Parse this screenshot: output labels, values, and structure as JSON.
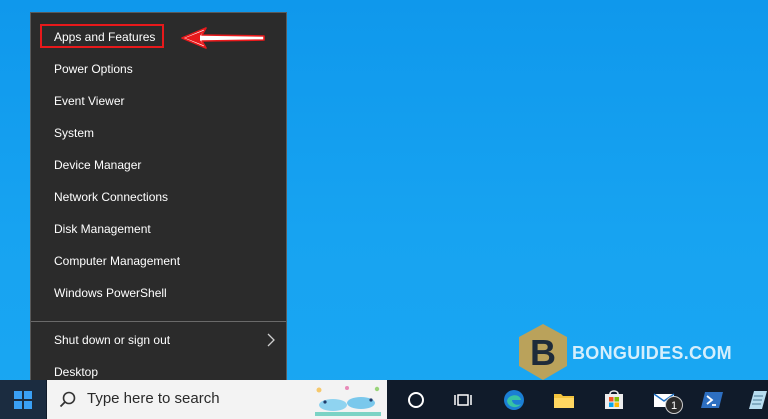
{
  "menu": {
    "items": [
      {
        "label": "Apps and Features"
      },
      {
        "label": "Power Options"
      },
      {
        "label": "Event Viewer"
      },
      {
        "label": "System"
      },
      {
        "label": "Device Manager"
      },
      {
        "label": "Network Connections"
      },
      {
        "label": "Disk Management"
      },
      {
        "label": "Computer Management"
      },
      {
        "label": "Windows PowerShell"
      },
      {
        "label": "Shut down or sign out"
      },
      {
        "label": "Desktop"
      }
    ],
    "highlight_color": "#e8191b"
  },
  "taskbar": {
    "search_placeholder": "Type here to search",
    "mail_badge": "1",
    "icons": [
      "windows-start-icon",
      "search-icon",
      "cortana-circle-icon",
      "task-view-icon",
      "edge-icon",
      "file-explorer-icon",
      "microsoft-store-icon",
      "mail-icon",
      "powershell-icon",
      "notepad-icon"
    ]
  },
  "watermark": {
    "text": "BONGUIDES.COM",
    "letter": "B"
  }
}
